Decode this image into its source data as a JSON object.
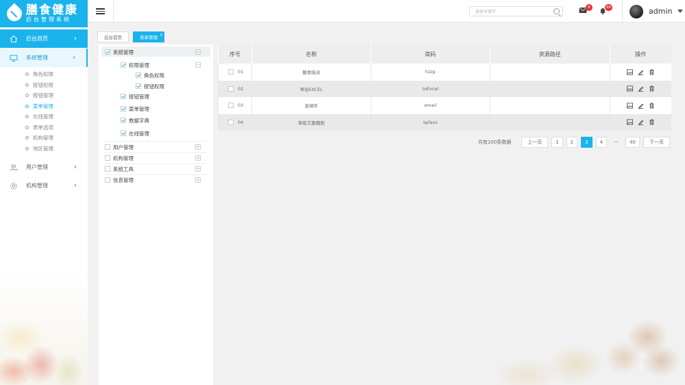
{
  "brand": {
    "title": "膳食健康",
    "subtitle": "后台管理系统"
  },
  "sidebar": {
    "items": [
      {
        "label": "后台首页",
        "icon": "home-icon"
      },
      {
        "label": "系统管理",
        "icon": "monitor-icon"
      },
      {
        "label": "用户管理",
        "icon": "users-icon"
      },
      {
        "label": "机构管理",
        "icon": "gear-icon"
      }
    ],
    "sub_items": [
      "角色权限",
      "按钮权限",
      "按钮管理",
      "菜单管理",
      "在线管理",
      "表单选项",
      "机构管理",
      "地区管理"
    ]
  },
  "header": {
    "search_placeholder": "搜索关键字",
    "mail_badge": "6",
    "bell_badge": "99",
    "username": "admin"
  },
  "tabs": [
    "后台首页",
    "菜单管理"
  ],
  "tree": {
    "root": "系统管理",
    "perm": "权限管理",
    "role_perm": "角色权限",
    "btn_perm": "按钮权限",
    "btn_mgmt": "按钮管理",
    "menu_mgmt": "菜单管理",
    "dict": "数据字典",
    "online": "在线管理",
    "user_mgmt": "用户管理",
    "org_mgmt": "机构管理",
    "tools": "系统工具",
    "info_mgmt": "信息管理"
  },
  "table": {
    "headers": [
      "序号",
      "名称",
      "简码",
      "资源路径",
      "操作"
    ],
    "rows": [
      {
        "seq": "01",
        "name": "膳食指派",
        "code": "hzzp",
        "path": ""
      },
      {
        "seq": "02",
        "name": "导出EXCEL",
        "code": "toExcel",
        "path": ""
      },
      {
        "seq": "03",
        "name": "发邮件",
        "code": "email",
        "path": ""
      },
      {
        "seq": "04",
        "name": "审批方案细则",
        "code": "spfaxz",
        "path": ""
      }
    ]
  },
  "pager": {
    "total": "共有100条数据",
    "prev": "上一页",
    "pages": [
      "1",
      "2",
      "3",
      "4"
    ],
    "ellipsis": "—",
    "last": "40",
    "next": "下一页",
    "current": "3"
  },
  "colors": {
    "accent": "#1ab3ec",
    "badge": "#e8333b"
  }
}
